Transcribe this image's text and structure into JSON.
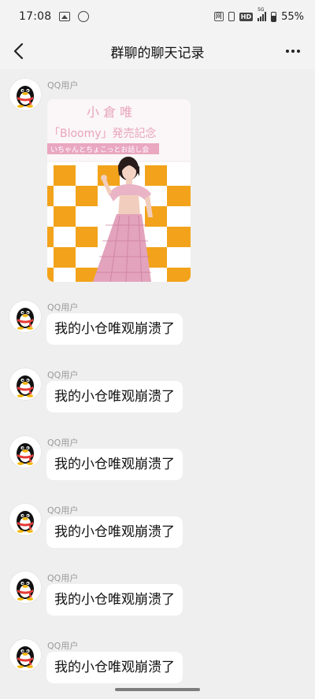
{
  "status_bar": {
    "time": "17:08",
    "battery": "55%",
    "hd_label": "HD",
    "net_label": "5G",
    "box_label": "网"
  },
  "nav": {
    "title": "群聊的聊天记录",
    "back_icon": "chevron-left-icon",
    "more_icon": "more-dots-icon"
  },
  "messages": [
    {
      "sender": "QQ用户",
      "type": "image",
      "image": {
        "banner_name": "小 倉 唯",
        "banner_line": "「Bloomy」発売記念",
        "banner_sub": "いちゃんとちょこっとお話し会"
      }
    },
    {
      "sender": "QQ用户",
      "type": "text",
      "text": "我的小仓唯观崩溃了"
    },
    {
      "sender": "QQ用户",
      "type": "text",
      "text": "我的小仓唯观崩溃了"
    },
    {
      "sender": "QQ用户",
      "type": "text",
      "text": "我的小仓唯观崩溃了"
    },
    {
      "sender": "QQ用户",
      "type": "text",
      "text": "我的小仓唯观崩溃了"
    },
    {
      "sender": "QQ用户",
      "type": "text",
      "text": "我的小仓唯观崩溃了"
    },
    {
      "sender": "QQ用户",
      "type": "text",
      "text": "我的小仓唯观崩溃了"
    }
  ],
  "colors": {
    "background": "#efefef",
    "bubble": "#ffffff",
    "sender_text": "#9a9a9a",
    "banner_pink": "#e9a7c0",
    "checker_orange": "#f2a31b"
  }
}
